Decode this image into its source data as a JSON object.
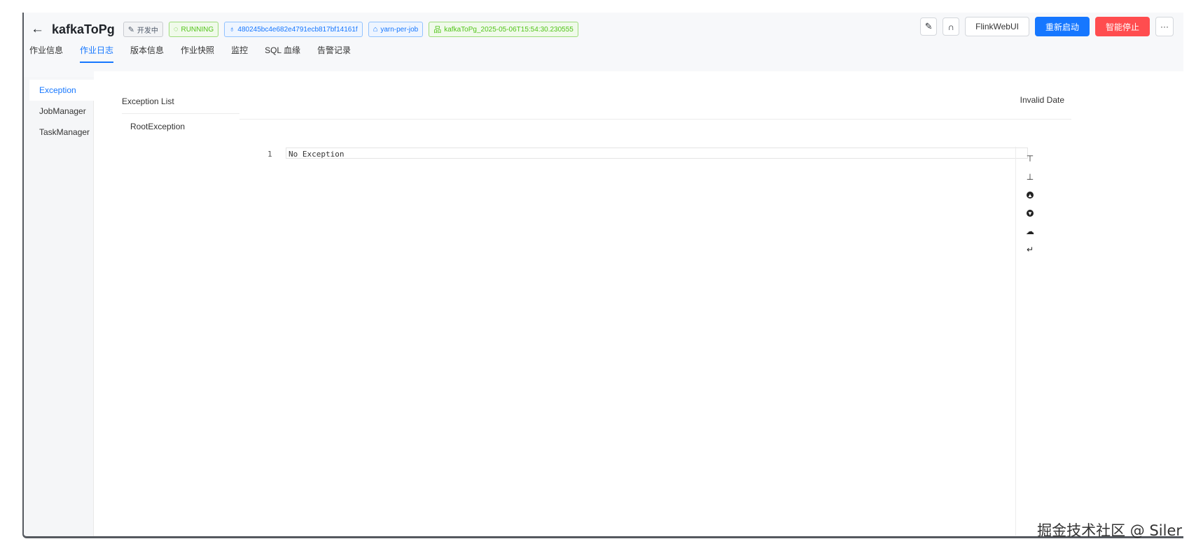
{
  "header": {
    "job_name": "kafkaToPg",
    "tags": {
      "dev": "开发中",
      "status": "RUNNING",
      "job_id": "480245bc4e682e4791ecb817bf14161f",
      "mode": "yarn-per-job",
      "instance": "kafkaToPg_2025-05-06T15:54:30.230555"
    },
    "actions": {
      "flink_web_ui": "FlinkWebUI",
      "restart": "重新启动",
      "smart_stop": "智能停止",
      "more": "···"
    }
  },
  "tabs": [
    "作业信息",
    "作业日志",
    "版本信息",
    "作业快照",
    "监控",
    "SQL 血缘",
    "告警记录"
  ],
  "active_tab": "作业日志",
  "side_tabs": [
    "Exception",
    "JobManager",
    "TaskManager"
  ],
  "active_side_tab": "Exception",
  "exception_panel": {
    "list_title": "Exception List",
    "items": [
      "RootException"
    ],
    "date": "Invalid Date",
    "editor_lines": [
      {
        "number": "1",
        "text": "No Exception"
      }
    ]
  },
  "toolbar_icons": [
    "scroll-top-icon",
    "scroll-bottom-icon",
    "arrow-up-circle-icon",
    "arrow-down-circle-icon",
    "cloud-download-icon",
    "wrap-icon"
  ],
  "watermark": "掘金技术社区 @ Siler",
  "colors": {
    "primary": "#1677ff",
    "danger": "#ff4d4f",
    "success": "#52c41a"
  }
}
